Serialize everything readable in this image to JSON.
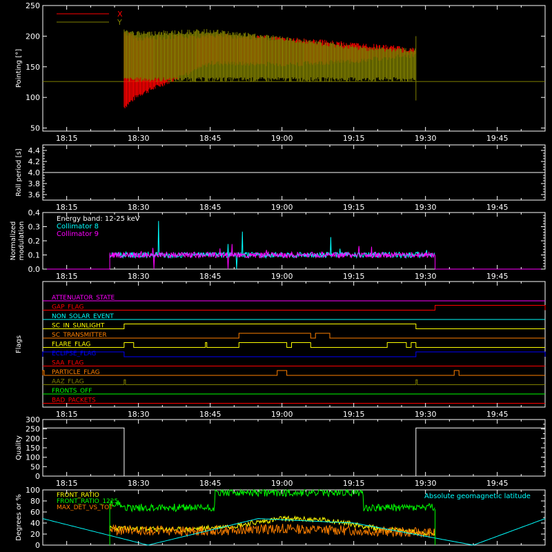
{
  "chart_data": [
    {
      "type": "line",
      "ylabel": "Pointing [°]",
      "yticks": [
        "50",
        "100",
        "150",
        "200",
        "250"
      ],
      "ylim": [
        45,
        250
      ],
      "xticks": [
        "18:15",
        "18:30",
        "18:45",
        "19:00",
        "19:15",
        "19:30",
        "19:45"
      ],
      "xlim_minutes": [
        1085,
        1194
      ],
      "legend": "top-left",
      "series": [
        {
          "name": "X",
          "color": "#ff0000",
          "x": [
            "18:27",
            "18:30",
            "18:45",
            "19:00",
            "19:15",
            "19:28"
          ],
          "low": [
            80,
            100,
            152,
            150,
            155,
            165
          ],
          "high": [
            210,
            200,
            205,
            200,
            190,
            182
          ]
        },
        {
          "name": "Y",
          "color": "#808000",
          "x": [
            "18:27",
            "18:30",
            "18:45",
            "19:00",
            "19:15",
            "19:28"
          ],
          "low": [
            125,
            125,
            125,
            125,
            125,
            125
          ],
          "high": [
            212,
            208,
            212,
            200,
            185,
            180
          ]
        }
      ],
      "reference_line": {
        "y": 126,
        "color": "#808000"
      }
    },
    {
      "type": "line",
      "ylabel": "Roll period [s]",
      "yticks": [
        "3.6",
        "3.8",
        "4.0",
        "4.2",
        "4.4"
      ],
      "ylim": [
        3.5,
        4.5
      ],
      "xticks": [
        "18:15",
        "18:30",
        "18:45",
        "19:00",
        "19:15",
        "19:30",
        "19:45"
      ],
      "series": [
        {
          "name": "",
          "x": [
            "18:10",
            "19:55"
          ],
          "y": [
            4.0,
            4.0
          ],
          "color": "#ffffff"
        }
      ]
    },
    {
      "type": "line",
      "ylabel": "Normalized modulation",
      "ylabel_lines": [
        "Normalized",
        "modulation"
      ],
      "yticks": [
        "0.0",
        "0.1",
        "0.2",
        "0.3",
        "0.4"
      ],
      "ylim": [
        0,
        0.4
      ],
      "xticks": [
        "18:15",
        "18:30",
        "18:45",
        "19:00",
        "19:15",
        "19:30",
        "19:45"
      ],
      "annotation": "Energy band: 12-25 keV",
      "series": [
        {
          "name": "Collimator 8",
          "color": "#00ffff",
          "x_range": [
            "18:24",
            "19:32"
          ],
          "mean": 0.1,
          "peak": 0.35
        },
        {
          "name": "Collimator 9",
          "color": "#ff00ff",
          "x_range": [
            "18:24",
            "19:32"
          ],
          "mean": 0.1,
          "peak": 0.2
        }
      ]
    },
    {
      "type": "line",
      "ylabel": "Flags",
      "xticks": [
        "18:15",
        "18:30",
        "18:45",
        "19:00",
        "19:15",
        "19:30",
        "19:45"
      ],
      "series": [
        {
          "name": "ATTENUATOR_STATE",
          "color": "#ff00ff",
          "on": []
        },
        {
          "name": "GAP_FLAG",
          "color": "#ff0000",
          "on": [
            [
              "19:32",
              "19:55"
            ]
          ]
        },
        {
          "name": "NON_SOLAR_EVENT",
          "color": "#00ffff",
          "on": []
        },
        {
          "name": "SC_IN_SUNLIGHT",
          "color": "#ffff00",
          "on": [
            [
              "18:27",
              "19:28"
            ]
          ]
        },
        {
          "name": "SC_TRANSMITTER",
          "color": "#ff8000",
          "on": [
            [
              "18:51",
              "19:06"
            ],
            [
              "19:07",
              "19:10"
            ]
          ]
        },
        {
          "name": "FLARE_FLAG",
          "color": "#ffff00",
          "on": [
            [
              "18:27",
              "18:29"
            ],
            [
              "18:44",
              "18:44"
            ],
            [
              "18:51",
              "19:01"
            ],
            [
              "19:02",
              "19:06"
            ],
            [
              "19:22",
              "19:26"
            ],
            [
              "19:27",
              "19:28"
            ]
          ]
        },
        {
          "name": "ECLIPSE_FLAG",
          "color": "#0000ff",
          "on": [
            [
              "18:10",
              "18:27"
            ],
            [
              "19:28",
              "19:55"
            ]
          ]
        },
        {
          "name": "SAA_FLAG",
          "color": "#ff0000",
          "on": []
        },
        {
          "name": "PARTICLE_FLAG",
          "color": "#ff8000",
          "on": [
            [
              "18:10",
              "18:10"
            ],
            [
              "18:59",
              "19:01"
            ],
            [
              "19:36",
              "19:37"
            ]
          ]
        },
        {
          "name": "AAZ_FLAG",
          "color": "#808000",
          "on": [
            [
              "18:27",
              "18:27"
            ],
            [
              "19:28",
              "19:28"
            ]
          ]
        },
        {
          "name": "FRONTS_OFF",
          "color": "#00ff00",
          "on": []
        },
        {
          "name": "BAD_PACKETS",
          "color": "#ff0000",
          "on": []
        }
      ]
    },
    {
      "type": "line",
      "ylabel": "Quality",
      "yticks": [
        "0",
        "50",
        "100",
        "150",
        "200",
        "250",
        "300"
      ],
      "ylim": [
        0,
        300
      ],
      "xticks": [
        "18:15",
        "18:30",
        "18:45",
        "19:00",
        "19:15",
        "19:30",
        "19:45"
      ],
      "series": [
        {
          "name": "",
          "color": "#ffffff",
          "x": [
            "18:10",
            "18:27",
            "18:27",
            "19:28",
            "19:28",
            "19:55"
          ],
          "y": [
            255,
            255,
            0,
            0,
            255,
            255
          ]
        }
      ]
    },
    {
      "type": "line",
      "ylabel": "Degrees or %",
      "yticks": [
        "0",
        "20",
        "40",
        "60",
        "80",
        "100"
      ],
      "ylim": [
        0,
        100
      ],
      "series": [
        {
          "name": "FRONT_RATIO",
          "color": "#ffff00",
          "x": [
            "18:24",
            "18:40",
            "18:50",
            "19:00",
            "19:10",
            "19:20",
            "19:32"
          ],
          "y": [
            30,
            28,
            35,
            48,
            45,
            30,
            20
          ]
        },
        {
          "name": "FRONT_RATIO_1225",
          "color": "#00ff00",
          "x": [
            "18:24",
            "18:27",
            "18:46",
            "18:47",
            "19:17",
            "19:18",
            "19:32"
          ],
          "y": [
            75,
            70,
            68,
            95,
            95,
            70,
            65
          ]
        },
        {
          "name": "MAX_DET_VS_TOT",
          "color": "#ff8000",
          "x": [
            "18:24",
            "18:40",
            "19:00",
            "19:20",
            "19:32"
          ],
          "y": [
            28,
            25,
            30,
            25,
            22
          ]
        },
        {
          "name": "Absolute geomagnetic latitude",
          "color": "#00ffff",
          "x": [
            "18:10",
            "18:32",
            "18:55",
            "19:15",
            "19:40",
            "19:55"
          ],
          "y": [
            48,
            0,
            48,
            40,
            0,
            48
          ]
        }
      ]
    }
  ]
}
